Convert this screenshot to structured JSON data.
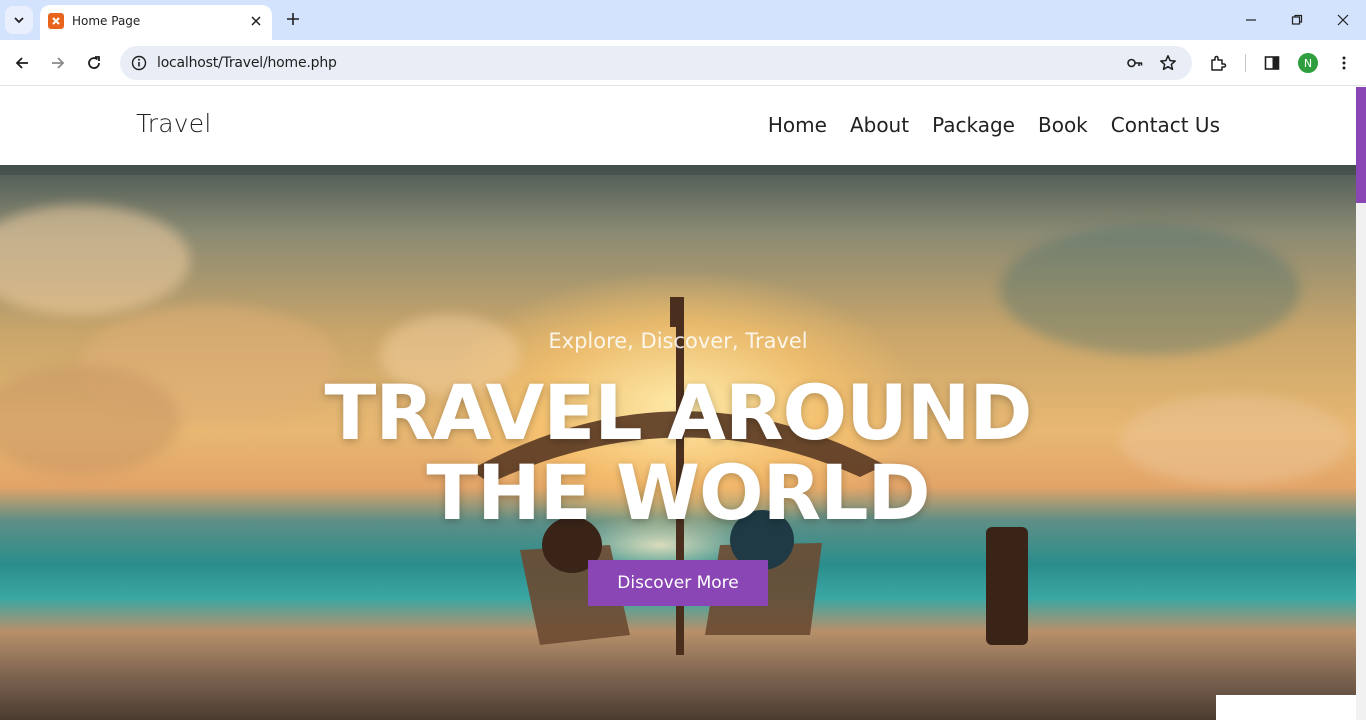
{
  "browser": {
    "tab_title": "Home Page",
    "url": "localhost/Travel/home.php",
    "profile_initial": "N",
    "icons": [
      "tab-list-icon",
      "xampp-favicon-icon",
      "close-icon",
      "plus-icon",
      "minimize-icon",
      "restore-icon",
      "close-window-icon",
      "back-icon",
      "forward-icon",
      "reload-icon",
      "info-icon",
      "key-icon",
      "star-icon",
      "extensions-icon",
      "side-panel-icon",
      "more-vert-icon"
    ]
  },
  "site": {
    "brand": "Travel",
    "nav": [
      "Home",
      "About",
      "Package",
      "Book",
      "Contact Us"
    ],
    "hero": {
      "subtitle": "Explore, Discover, Travel",
      "title_line1": "TRAVEL AROUND",
      "title_line2": "THE WORLD",
      "cta": "Discover More"
    },
    "colors": {
      "accent": "#8a46b4",
      "chrome_tabbar": "#d3e3fd",
      "omnibox": "#e9eef6"
    }
  }
}
